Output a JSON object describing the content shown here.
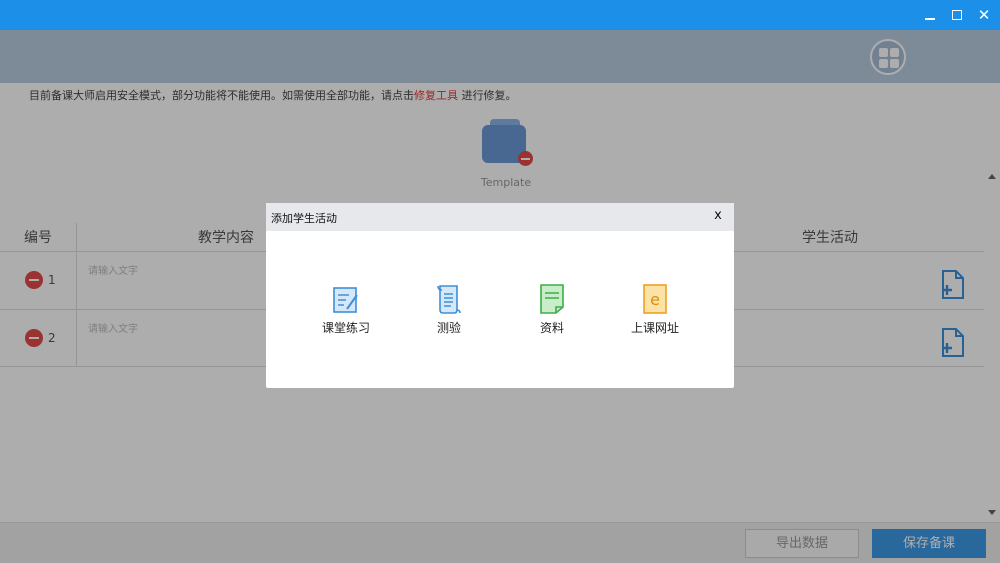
{
  "window": {
    "minimize_glyph": "minimize-icon",
    "maximize_glyph": "maximize-icon",
    "close_label": "✕"
  },
  "header": {
    "layout_icon": "grid-layout-icon"
  },
  "notice": {
    "before": "目前备课大师启用安全模式，部分功能将不能使用。如需使用全部功能，请点击",
    "link": "修复工具",
    "after": "进行修复。"
  },
  "template": {
    "label": "Template",
    "icon": "template-folder-icon"
  },
  "table": {
    "columns": [
      "编号",
      "教学内容",
      "学生活动"
    ],
    "rows": [
      {
        "number": "1",
        "placeholder": "请输入文字"
      },
      {
        "number": "2",
        "placeholder": "请输入文字"
      }
    ]
  },
  "footer": {
    "export_label": "导出数据",
    "save_label": "保存备课"
  },
  "modal": {
    "title": "添加学生活动",
    "close_label": "x",
    "activities": [
      {
        "label": "课堂练习",
        "icon": "exercise-icon",
        "color": "#3d8fd8"
      },
      {
        "label": "测验",
        "icon": "quiz-scroll-icon",
        "color": "#3d8fd8"
      },
      {
        "label": "资料",
        "icon": "material-doc-icon",
        "color": "#3cae4a"
      },
      {
        "label": "上课网址",
        "icon": "web-url-icon",
        "color": "#f0a020"
      }
    ]
  },
  "colors": {
    "titlebar": "#1c8fe8",
    "primary_button": "#3d9ae8",
    "danger": "#e34b4b",
    "link": "#e53935"
  }
}
